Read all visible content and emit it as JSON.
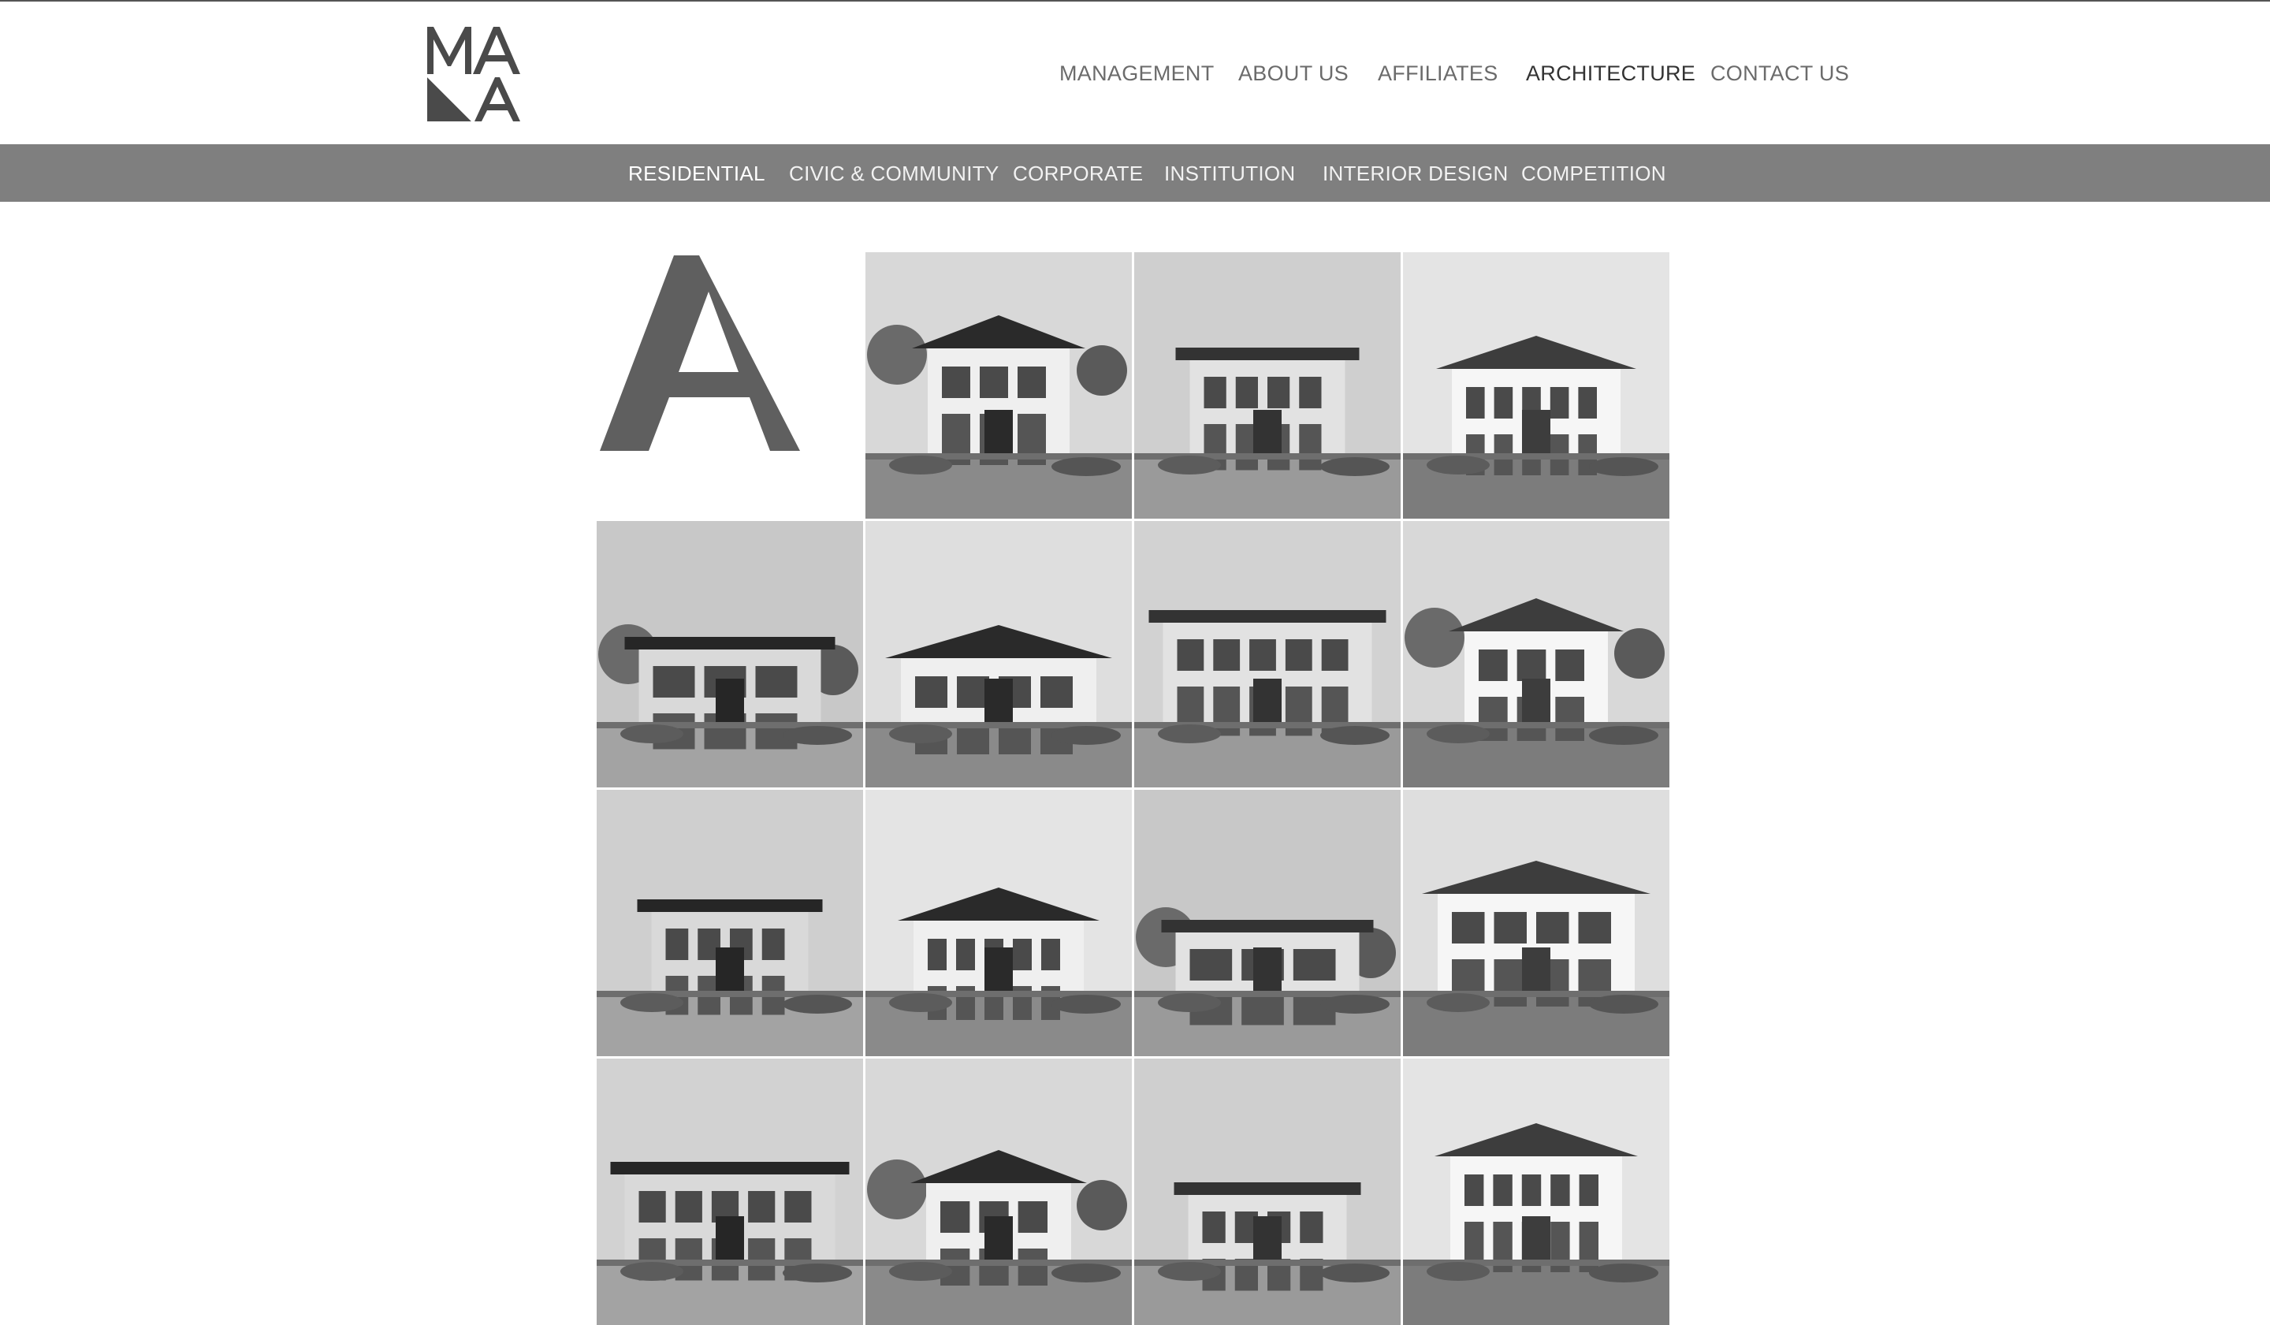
{
  "logo": {
    "line1": "MA",
    "line2": "A",
    "name": "MANA"
  },
  "main_nav": {
    "items": [
      {
        "label": "MANAGEMENT",
        "active": false
      },
      {
        "label": "ABOUT US",
        "active": false
      },
      {
        "label": "AFFILIATES",
        "active": false
      },
      {
        "label": "ARCHITECTURE",
        "active": true
      },
      {
        "label": "CONTACT US",
        "active": false
      }
    ]
  },
  "sub_nav": {
    "items": [
      {
        "label": "RESIDENTIAL",
        "active": true
      },
      {
        "label": "CIVIC & COMMUNITY",
        "active": false
      },
      {
        "label": "CORPORATE",
        "active": false
      },
      {
        "label": "INSTITUTION",
        "active": false
      },
      {
        "label": "INTERIOR DESIGN",
        "active": false
      },
      {
        "label": "COMPETITION",
        "active": false
      }
    ]
  },
  "gallery": {
    "initial": "A",
    "photos": [
      "modern-entrance-canopy",
      "columned-porch-entry",
      "two-storey-house-with-gate",
      "glass-facade-house",
      "mediterranean-house-with-garden",
      "resort-building-walkway",
      "pergola-garden-house",
      "modern-house-driveway",
      "house-with-dark-garage",
      "white-modern-house-with-plants",
      "bungalow-with-car",
      "flat-roof-house",
      "modern-cantilever-house",
      "house-with-tree",
      "hip-roof-house"
    ]
  },
  "colors": {
    "subnav_bg": "#7f7f7f",
    "nav_text": "#6b6b6b",
    "nav_active": "#333333",
    "logo": "#4a4a4a"
  }
}
